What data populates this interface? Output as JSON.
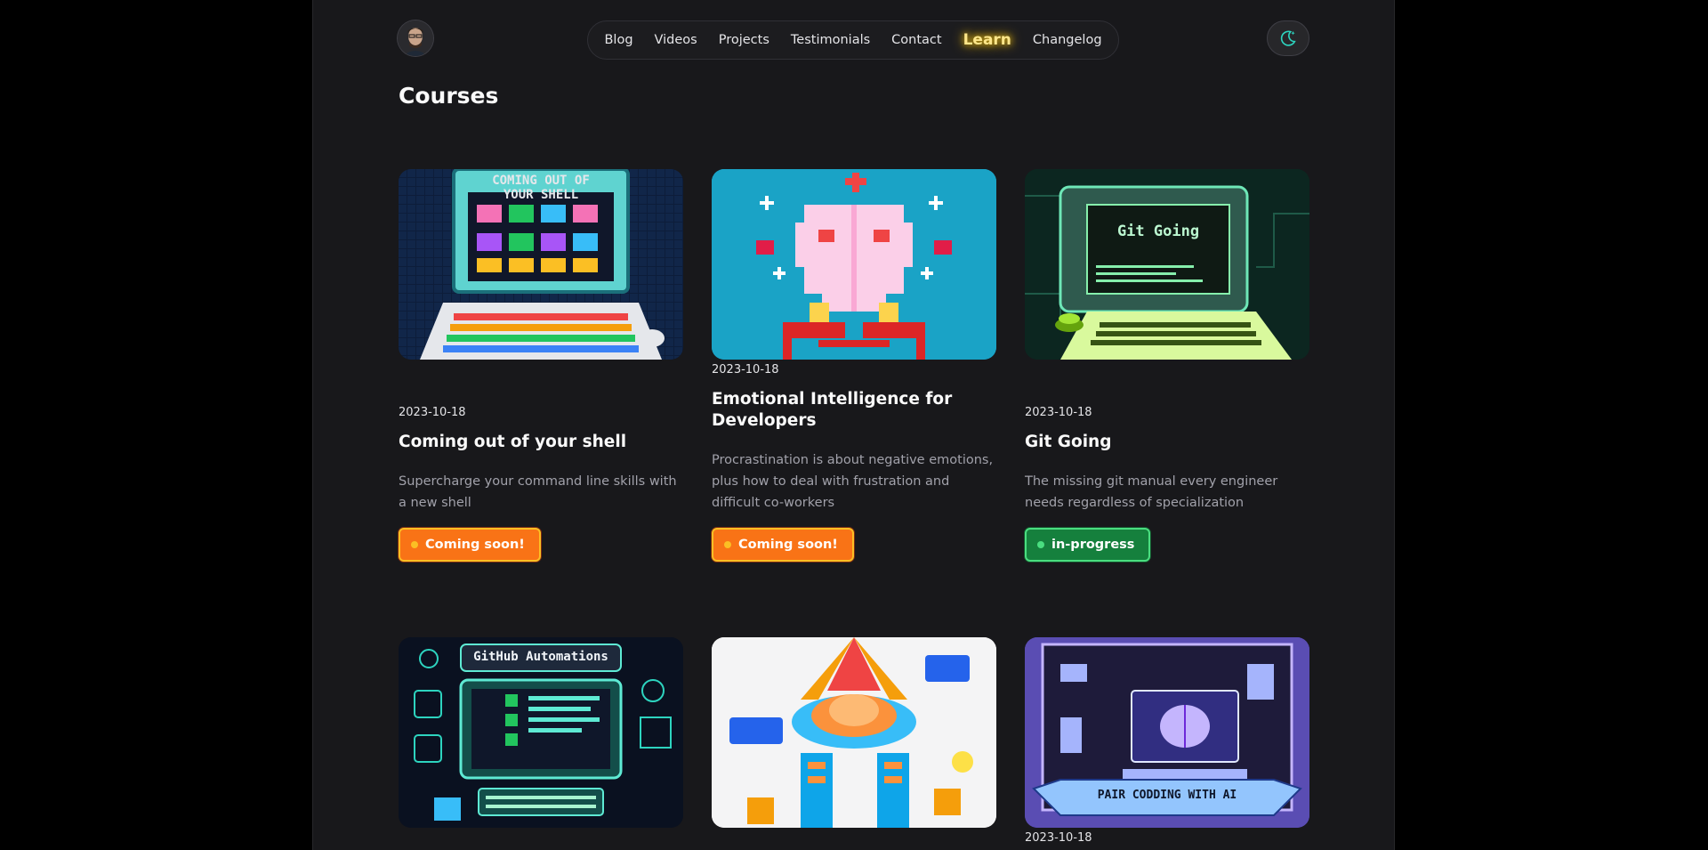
{
  "nav": {
    "items": [
      "Blog",
      "Videos",
      "Projects",
      "Testimonials",
      "Contact",
      "Learn",
      "Changelog"
    ],
    "active": "Learn"
  },
  "theme_toggle_icon": "moon-sparkle-icon",
  "page": {
    "title": "Courses"
  },
  "courses": [
    {
      "date": "2023-10-18",
      "title": "Coming out of your shell",
      "description": "Supercharge your command line skills with a new shell",
      "status": "Coming soon!",
      "image_text": "COMING OUT OF YOUR SHELL"
    },
    {
      "date": "2023-10-18",
      "title": "Emotional Intelligence for Developers",
      "description": "Procrastination is about negative emotions, plus how to deal with frustration and difficult co-workers",
      "status": "Coming soon!"
    },
    {
      "date": "2023-10-18",
      "title": "Git Going",
      "description": "The missing git manual every engineer needs regardless of specialization",
      "status": "in-progress",
      "image_text": "Git Going"
    },
    {
      "image_text": "GitHub Automations"
    },
    {},
    {
      "date": "2023-10-18",
      "image_text": "PAIR CODDING WITH AI"
    }
  ],
  "colors": {
    "coming_soon": "#f97316",
    "in_progress": "#15803d",
    "learn_glow": "#facc15"
  }
}
